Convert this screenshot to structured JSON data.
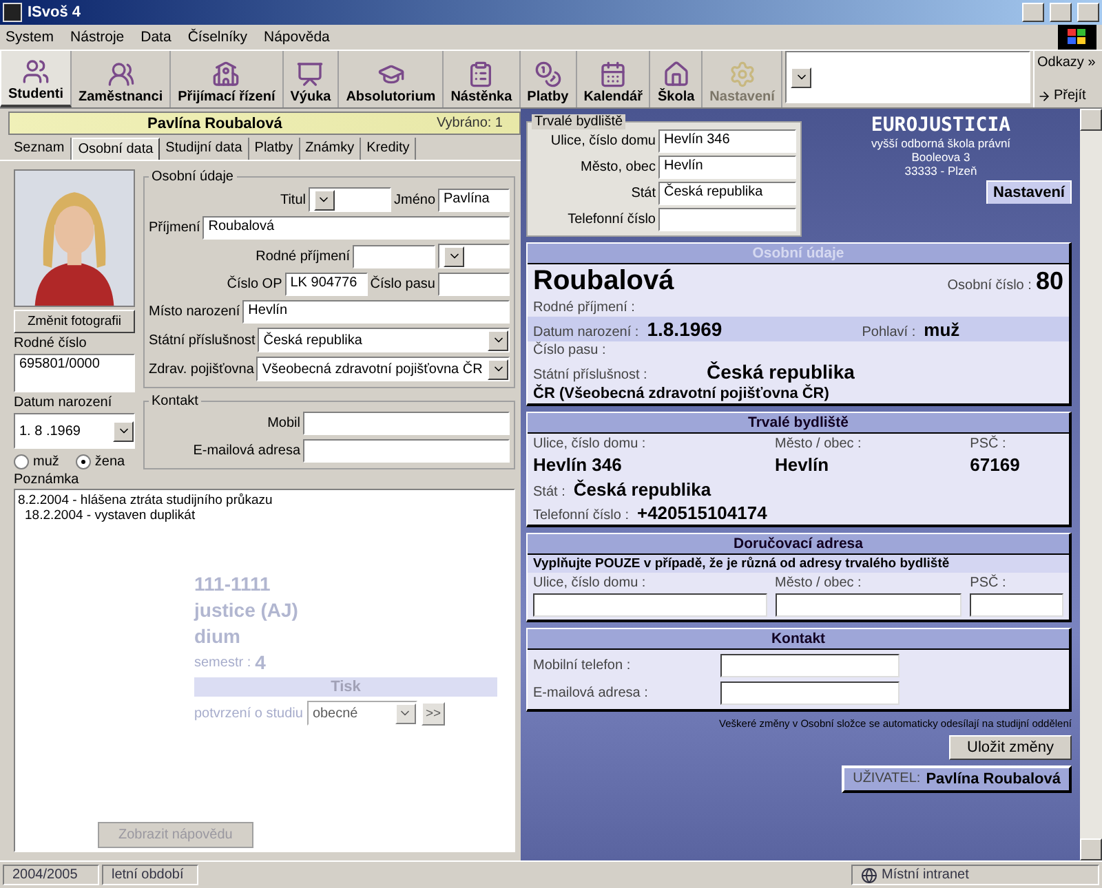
{
  "window": {
    "title": "ISvoš 4"
  },
  "menu": [
    "System",
    "Nástroje",
    "Data",
    "Číselníky",
    "Nápověda"
  ],
  "toolbar": {
    "buttons": [
      {
        "label": "Studenti",
        "selected": true,
        "disabled": false
      },
      {
        "label": "Zaměstnanci",
        "selected": false,
        "disabled": false
      },
      {
        "label": "Přijímací řízení",
        "selected": false,
        "disabled": false
      },
      {
        "label": "Výuka",
        "selected": false,
        "disabled": false
      },
      {
        "label": "Absolutorium",
        "selected": false,
        "disabled": false
      },
      {
        "label": "Nástěnka",
        "selected": false,
        "disabled": false
      },
      {
        "label": "Platby",
        "selected": false,
        "disabled": false
      },
      {
        "label": "Kalendář",
        "selected": false,
        "disabled": false
      },
      {
        "label": "Škola",
        "selected": false,
        "disabled": false
      },
      {
        "label": "Nastavení",
        "selected": false,
        "disabled": true
      }
    ],
    "links_label": "Odkazy",
    "links_arrow": "»",
    "go_button": "Přejít"
  },
  "record_bar": {
    "name": "Pavlína Roubalová",
    "selected_count": "Vybráno: 1"
  },
  "tabs": [
    {
      "label": "Seznam",
      "selected": false
    },
    {
      "label": "Osobní data",
      "selected": true
    },
    {
      "label": "Studijní data",
      "selected": false
    },
    {
      "label": "Platby",
      "selected": false
    },
    {
      "label": "Známky",
      "selected": false
    },
    {
      "label": "Kredity",
      "selected": false
    }
  ],
  "photo": {
    "kind": "picture",
    "button": "Změnit fotografii"
  },
  "birth_number": {
    "label": "Rodné číslo",
    "value": "695801/0000"
  },
  "birth_date": {
    "label": "Datum narození",
    "value": "1. 8 .1969"
  },
  "gender": [
    {
      "label": "muž",
      "selected": false
    },
    {
      "label": "žena",
      "selected": true
    }
  ],
  "personal_group": {
    "title": "Osobní údaje",
    "rows": [
      {
        "fields": [
          {
            "label": "Titul",
            "kind": "combo"
          },
          {
            "label": "Jméno",
            "value": "Pavlína",
            "kind": "text"
          }
        ]
      },
      {
        "fields": [
          {
            "label": "Příjmení",
            "value": "Roubalová",
            "kind": "text"
          }
        ]
      },
      {
        "fields": [
          {
            "label": "Rodné příjmení",
            "kind": "text"
          },
          {
            "kind": "combo"
          }
        ]
      },
      {
        "fields": [
          {
            "label": "Číslo OP",
            "value": "LK 904776",
            "kind": "text"
          },
          {
            "label": "Číslo pasu",
            "kind": "text"
          }
        ]
      },
      {
        "fields": [
          {
            "label": "Místo narození",
            "value": "Hevlín",
            "kind": "text"
          }
        ]
      },
      {
        "fields": [
          {
            "label": "Státní příslušnost",
            "value": "Česká republika",
            "kind": "combo"
          }
        ]
      },
      {
        "fields": [
          {
            "label": "Zdrav. pojišťovna",
            "value": "Všeobecná zdravotní pojišťovna ČR",
            "kind": "combo"
          }
        ]
      }
    ]
  },
  "contact_group": {
    "title": "Kontakt",
    "fields": [
      {
        "label": "Mobil"
      },
      {
        "label": "E-mailová adresa"
      }
    ]
  },
  "note": {
    "label": "Poznámka",
    "lines": [
      {
        "text": "8.2.2004 - hlášena ztráta studijního průkazu",
        "indented": false
      },
      {
        "text": "18.2.2004 - vystaven duplikát",
        "indented": true
      }
    ]
  },
  "faded_page": {
    "phone": "111-1111",
    "field": "justice (AJ)",
    "form": "dium",
    "semester_label": "semestr :",
    "semester": "4",
    "print": {
      "title": "Tisk",
      "label": "potvrzení o studiu",
      "value": "obecné",
      "button": ">>"
    },
    "help_button": "Zobrazit nápovědu"
  },
  "residence_group": {
    "title": "Trvalé bydliště",
    "fields": [
      {
        "label": "Ulice, číslo domu",
        "value": "Hevlín 346"
      },
      {
        "label": "Město, obec",
        "value": "Hevlín"
      },
      {
        "label": "Stát",
        "value": "Česká republika"
      },
      {
        "label": "Telefonní číslo"
      }
    ]
  },
  "school": {
    "name": "EUROJUSTICIA",
    "lines": [
      "vyšší odborná škola právní",
      "Booleova 3",
      "33333 - Plzeň"
    ],
    "settings_tab": "Nastavení"
  },
  "personal_card": {
    "title": "Osobní údaje",
    "surname": "Roubalová",
    "number_label": "Osobní číslo :",
    "number": "80",
    "birth_surname_label": "Rodné příjmení :",
    "birth_date_label": "Datum narození :",
    "birth_date": "1.8.1969",
    "gender_label": "Pohlaví :",
    "gender": "muž",
    "passport_label": "Číslo pasu :",
    "citizenship_label": "Státní příslušnost :",
    "citizenship": "Česká republika",
    "insurance": "ČR (Všeobecná zdravotní pojišťovna ČR)"
  },
  "residence_card": {
    "title": "Trvalé bydliště",
    "items": [
      {
        "label": "Ulice, číslo domu :",
        "value": "Hevlín 346"
      },
      {
        "label": "Město / obec :",
        "value": "Hevlín"
      },
      {
        "label": "PSČ :",
        "value": "67169"
      }
    ],
    "state_label": "Stát :",
    "state": "Česká republika",
    "phone_label": "Telefonní číslo :",
    "phone": "+420515104174"
  },
  "delivery_card": {
    "title": "Doručovací adresa",
    "hint": "Vyplňujte POUZE v případě, že je různá od adresy trvalého bydliště",
    "fields": [
      "Ulice, číslo domu :",
      "Město / obec :",
      "PSČ :"
    ]
  },
  "contact_card": {
    "title": "Kontakt",
    "fields": [
      "Mobilní telefon :",
      "E-mailová adresa :"
    ]
  },
  "notice": "Veškeré změny v Osobní složce se automaticky odesílají na studijní oddělení",
  "save_button": "Uložit změny",
  "user": {
    "label": "UŽIVATEL:",
    "name": "Pavlína Roubalová"
  },
  "status_bar": {
    "year": "2004/2005",
    "period": "letní období",
    "zone": "Místní intranet"
  }
}
